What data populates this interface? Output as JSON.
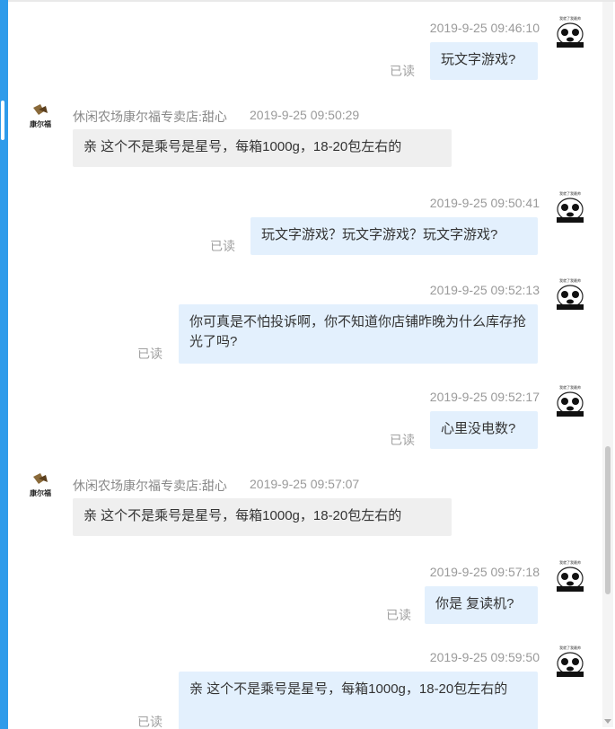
{
  "colors": {
    "accent": "#2f9bea",
    "bubble_out": "#e3f0fd",
    "bubble_in": "#efefef",
    "meta_text": "#9a9a9a"
  },
  "shop_avatar_text": "康尔福",
  "panda_caption": "我就了我最帅",
  "messages": [
    {
      "type": "out",
      "time": "2019-9-25 09:46:10",
      "text": "玩文字游戏?",
      "status": "已读"
    },
    {
      "type": "in",
      "sender": "休闲农场康尔福专卖店:甜心",
      "time": "2019-9-25 09:50:29",
      "text": "亲 这个不是乘号是星号，每箱1000g，18-20包左右的"
    },
    {
      "type": "out",
      "time": "2019-9-25 09:50:41",
      "text": "玩文字游戏？玩文字游戏？玩文字游戏?",
      "status": "已读"
    },
    {
      "type": "out",
      "time": "2019-9-25 09:52:13",
      "text": "你可真是不怕投诉啊，你不知道你店铺昨晚为什么库存抢光了吗?",
      "status": "已读"
    },
    {
      "type": "out",
      "time": "2019-9-25 09:52:17",
      "text": "心里没电数?",
      "status": "已读"
    },
    {
      "type": "in",
      "sender": "休闲农场康尔福专卖店:甜心",
      "time": "2019-9-25 09:57:07",
      "text": "亲 这个不是乘号是星号，每箱1000g，18-20包左右的"
    },
    {
      "type": "out",
      "time": "2019-9-25 09:57:18",
      "text": "你是 复读机?",
      "status": "已读"
    },
    {
      "type": "out",
      "time": "2019-9-25 09:59:50",
      "text": "亲 这个不是乘号是星号，每箱1000g，18-20包左右的",
      "status": "已读"
    }
  ]
}
